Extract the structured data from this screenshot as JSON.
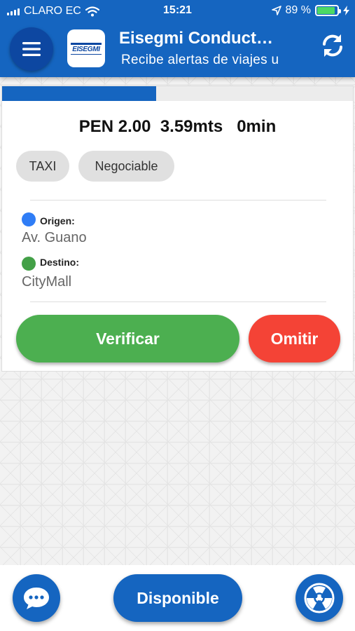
{
  "status_bar": {
    "carrier": "CLARO EC",
    "time": "15:21",
    "battery_percent": "89 %",
    "battery_level": 0.89
  },
  "header": {
    "logo_text": "EISEGMI",
    "title": "Eisegmi Conduct…",
    "subtitle": "Recibe alertas de viajes u",
    "icons": [
      "menu-icon",
      "refresh-icon"
    ]
  },
  "trip_card": {
    "progress": 0.44,
    "summary": "PEN 2.00  3.59mts   0min",
    "tags": [
      "TAXI",
      "Negociable"
    ],
    "origin": {
      "label": "Origen:",
      "value": "Av. Guano",
      "color": "#2f7df6"
    },
    "destination": {
      "label": "Destino:",
      "value": "CityMall",
      "color": "#43a047"
    },
    "verify_label": "Verificar",
    "skip_label": "Omitir",
    "colors": {
      "verify": "#4caf50",
      "skip": "#f44336",
      "accent": "#1565c0"
    }
  },
  "bottom_bar": {
    "available_label": "Disponible",
    "icons": [
      "chat-icon",
      "radioactive-icon"
    ]
  }
}
